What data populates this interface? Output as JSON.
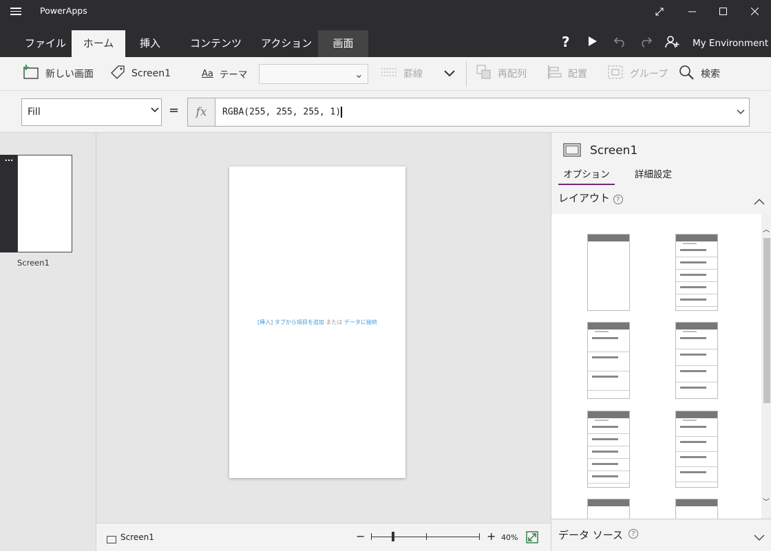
{
  "app": {
    "title": "PowerApps"
  },
  "ribbon": {
    "tabs": [
      "ファイル",
      "ホーム",
      "挿入",
      "コンテンツ",
      "アクション",
      "画面"
    ],
    "environment": "My Environment",
    "help": "?"
  },
  "toolbar": {
    "new_screen": "新しい画面",
    "screen_name": "Screen1",
    "theme": "テーマ",
    "border": "罫線",
    "reorder": "再配列",
    "align": "配置",
    "group": "グループ",
    "search": "検索"
  },
  "formula": {
    "property": "Fill",
    "equals": "=",
    "fx": "fx",
    "value": "RGBA(255, 255, 255, 1)"
  },
  "left": {
    "thumb_menu": "...",
    "screen_label": "Screen1"
  },
  "canvas": {
    "hint_insert": "[挿入] タブから項目を追加",
    "hint_or": "または",
    "hint_data": "データに接続"
  },
  "status": {
    "screen_label": "Screen1",
    "zoom": "40%",
    "zoom_minus": "−",
    "zoom_plus": "+",
    "zoom_level": 0.4
  },
  "right": {
    "title": "Screen1",
    "tabs": [
      "オプション",
      "詳細設定"
    ],
    "layout_header": "レイアウト",
    "data_source": "データ ソース",
    "help": "?"
  },
  "colors": {
    "titlebar": "#2d2d30",
    "accent": "#742774",
    "link": "#3d9bd8"
  }
}
